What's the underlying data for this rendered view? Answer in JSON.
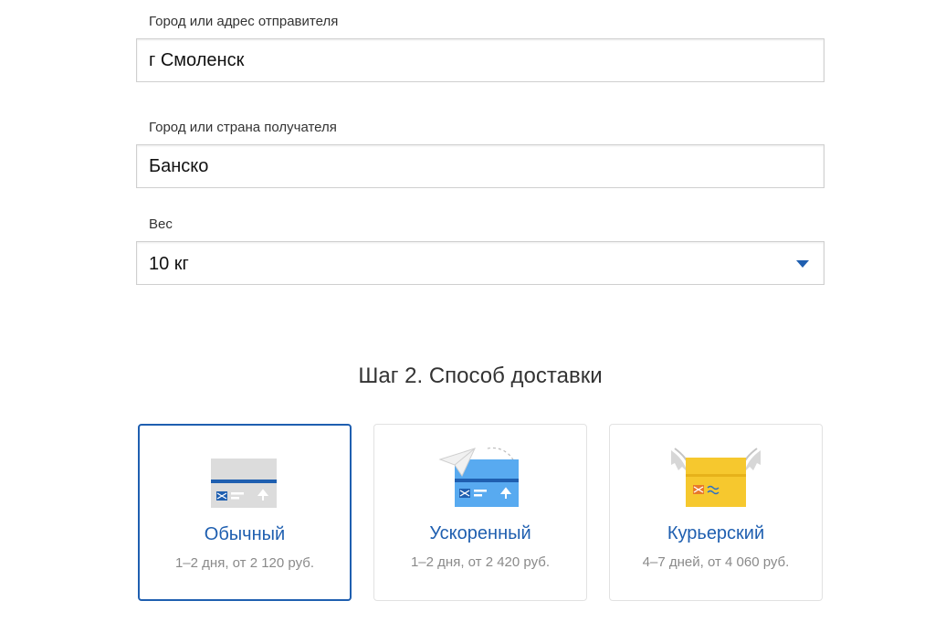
{
  "form": {
    "sender": {
      "label": "Город или адрес отправителя",
      "value": "г Смоленск"
    },
    "recipient": {
      "label": "Город или страна получателя",
      "value": "Банско"
    },
    "weight": {
      "label": "Вес",
      "selected": "10 кг",
      "icon": "chevron-down-icon"
    }
  },
  "step2": {
    "title": "Шаг 2. Способ доставки",
    "options": [
      {
        "title": "Обычный",
        "details": "1–2 дня, от 2 120 руб.",
        "icon": "parcel-standard-icon",
        "selected": true
      },
      {
        "title": "Ускоренный",
        "details": "1–2 дня, от 2 420 руб.",
        "icon": "parcel-express-icon",
        "selected": false
      },
      {
        "title": "Курьерский",
        "details": "4–7 дней, от 4 060 руб.",
        "icon": "parcel-courier-icon",
        "selected": false
      }
    ]
  },
  "colors": {
    "accent": "#1f5fb0",
    "express": "#4da3f0",
    "courier": "#f6c82e",
    "standard": "#d9d9d9"
  }
}
